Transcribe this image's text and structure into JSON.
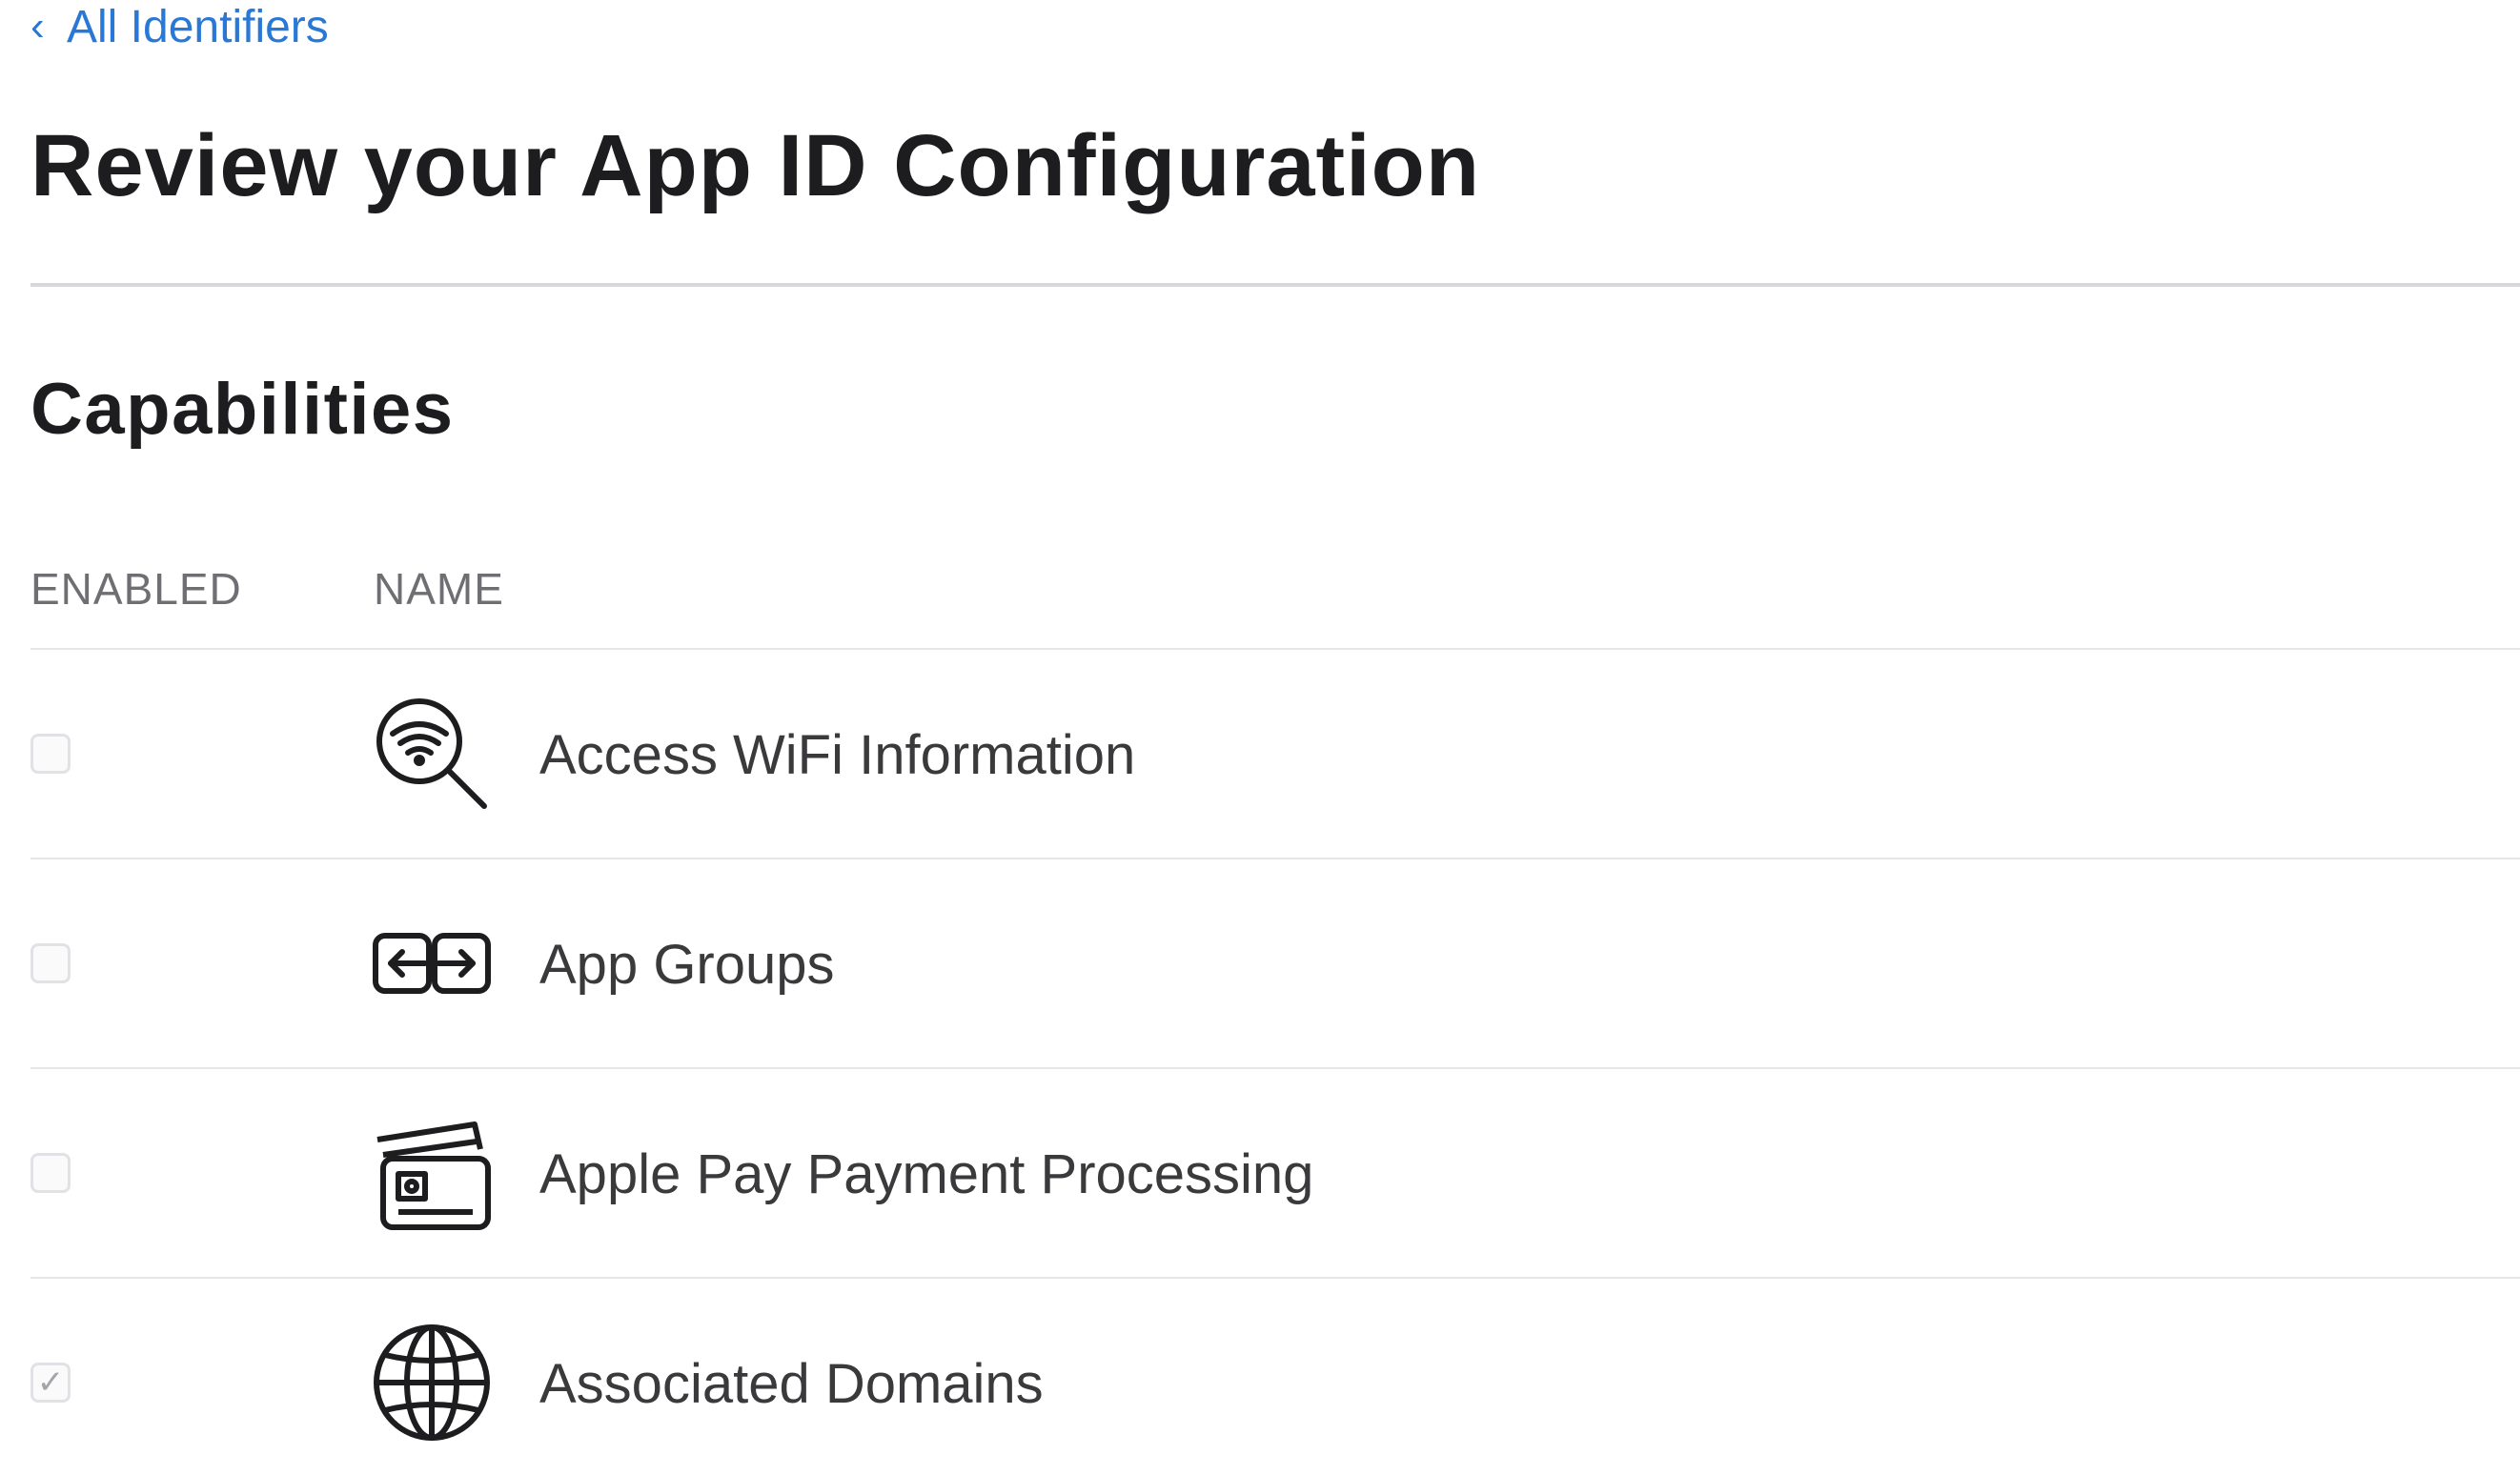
{
  "nav": {
    "back_chevron": "‹",
    "back_label": "All Identifiers"
  },
  "header": {
    "title": "Review your App ID Configuration"
  },
  "capabilities": {
    "title": "Capabilities",
    "columns": {
      "enabled": "ENABLED",
      "name": "NAME"
    },
    "items": [
      {
        "name": "Access WiFi Information",
        "icon": "wifi-search-icon",
        "enabled": false,
        "check_glyph": ""
      },
      {
        "name": "App Groups",
        "icon": "app-groups-icon",
        "enabled": false,
        "check_glyph": ""
      },
      {
        "name": "Apple Pay Payment Processing",
        "icon": "payment-cards-icon",
        "enabled": false,
        "check_glyph": ""
      },
      {
        "name": "Associated Domains",
        "icon": "globe-icon",
        "enabled": true,
        "check_glyph": "✓"
      }
    ]
  },
  "colors": {
    "link": "#2a78d6",
    "text": "#1d1d1f",
    "divider": "#d8d8dc"
  }
}
